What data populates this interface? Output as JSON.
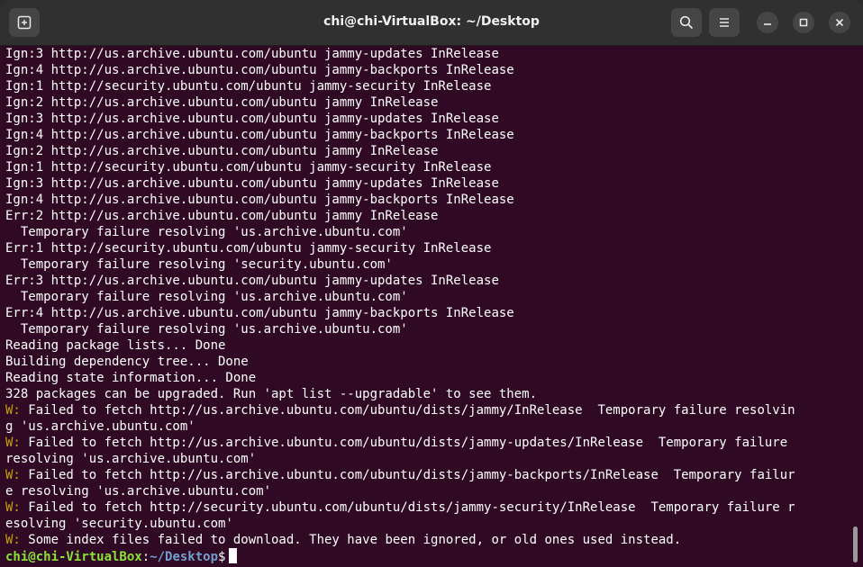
{
  "window": {
    "title": "chi@chi-VirtualBox: ~/Desktop"
  },
  "icons": {
    "new_tab": "new-tab-icon",
    "search": "search-icon",
    "menu": "hamburger-menu-icon",
    "minimize": "minimize-icon",
    "maximize": "maximize-icon",
    "close": "close-icon"
  },
  "colors": {
    "background": "#300a24",
    "titlebar": "#303030",
    "text": "#ffffff",
    "warning": "#c4a000",
    "prompt_user": "#8ae234",
    "prompt_path": "#729fcf"
  },
  "terminal": {
    "lines": [
      "Ign:3 http://us.archive.ubuntu.com/ubuntu jammy-updates InRelease",
      "Ign:4 http://us.archive.ubuntu.com/ubuntu jammy-backports InRelease",
      "Ign:1 http://security.ubuntu.com/ubuntu jammy-security InRelease",
      "Ign:2 http://us.archive.ubuntu.com/ubuntu jammy InRelease",
      "Ign:3 http://us.archive.ubuntu.com/ubuntu jammy-updates InRelease",
      "Ign:4 http://us.archive.ubuntu.com/ubuntu jammy-backports InRelease",
      "Ign:2 http://us.archive.ubuntu.com/ubuntu jammy InRelease",
      "Ign:1 http://security.ubuntu.com/ubuntu jammy-security InRelease",
      "Ign:3 http://us.archive.ubuntu.com/ubuntu jammy-updates InRelease",
      "Ign:4 http://us.archive.ubuntu.com/ubuntu jammy-backports InRelease",
      "Err:2 http://us.archive.ubuntu.com/ubuntu jammy InRelease",
      "  Temporary failure resolving 'us.archive.ubuntu.com'",
      "Err:1 http://security.ubuntu.com/ubuntu jammy-security InRelease",
      "  Temporary failure resolving 'security.ubuntu.com'",
      "Err:3 http://us.archive.ubuntu.com/ubuntu jammy-updates InRelease",
      "  Temporary failure resolving 'us.archive.ubuntu.com'",
      "Err:4 http://us.archive.ubuntu.com/ubuntu jammy-backports InRelease",
      "  Temporary failure resolving 'us.archive.ubuntu.com'",
      "Reading package lists... Done",
      "Building dependency tree... Done",
      "Reading state information... Done",
      "328 packages can be upgraded. Run 'apt list --upgradable' to see them."
    ],
    "warning_prefix": "W:",
    "warnings": [
      " Failed to fetch http://us.archive.ubuntu.com/ubuntu/dists/jammy/InRelease  Temporary failure resolvin",
      "g 'us.archive.ubuntu.com'",
      " Failed to fetch http://us.archive.ubuntu.com/ubuntu/dists/jammy-updates/InRelease  Temporary failure",
      "resolving 'us.archive.ubuntu.com'",
      " Failed to fetch http://us.archive.ubuntu.com/ubuntu/dists/jammy-backports/InRelease  Temporary failur",
      "e resolving 'us.archive.ubuntu.com'",
      " Failed to fetch http://security.ubuntu.com/ubuntu/dists/jammy-security/InRelease  Temporary failure r",
      "esolving 'security.ubuntu.com'",
      " Some index files failed to download. They have been ignored, or old ones used instead."
    ],
    "prompt": {
      "user_host": "chi@chi-VirtualBox",
      "separator": ":",
      "path": "~/Desktop",
      "symbol": "$"
    }
  }
}
